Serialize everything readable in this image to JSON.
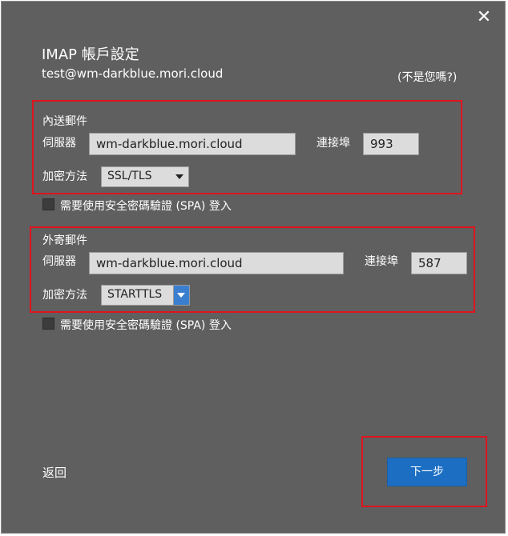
{
  "dialog": {
    "close_glyph": "✕",
    "title": "IMAP 帳戶設定",
    "email": "test@wm-darkblue.mori.cloud",
    "not_you": "(不是您嗎?)"
  },
  "incoming": {
    "section_label": "內送郵件",
    "server_label": "伺服器",
    "server_value": "wm-darkblue.mori.cloud",
    "port_label": "連接埠",
    "port_value": "993",
    "encryption_label": "加密方法",
    "encryption_value": "SSL/TLS",
    "spa_label": "需要使用安全密碼驗證 (SPA) 登入"
  },
  "outgoing": {
    "section_label": "外寄郵件",
    "server_label": "伺服器",
    "server_value": "wm-darkblue.mori.cloud",
    "port_label": "連接埠",
    "port_value": "587",
    "encryption_label": "加密方法",
    "encryption_value": "STARTTLS",
    "spa_label": "需要使用安全密碼驗證 (SPA) 登入"
  },
  "footer": {
    "back_label": "返回",
    "next_label": "下一步"
  },
  "colors": {
    "dialog_bg": "#5f5f5f",
    "highlight": "#e0141e",
    "primary_button": "#1b6ec2",
    "select_arrow_active": "#3a7fcf"
  },
  "icons": {
    "close": "close-icon",
    "dropdown": "chevron-down-icon"
  }
}
